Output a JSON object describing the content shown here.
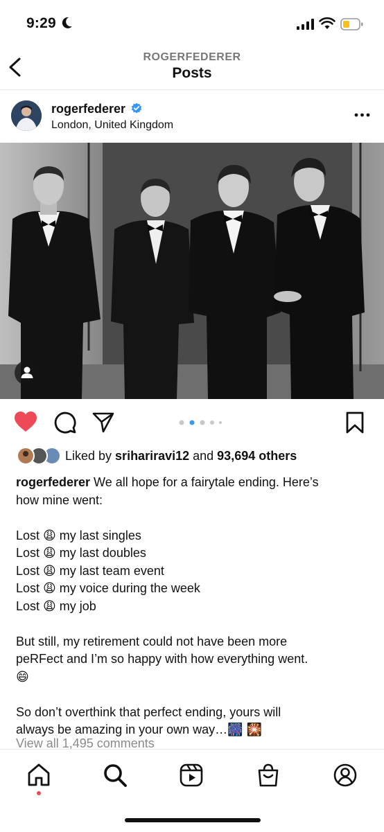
{
  "status_bar": {
    "time": "9:29"
  },
  "header": {
    "account": "ROGERFEDERER",
    "title": "Posts"
  },
  "post": {
    "username": "rogerfederer",
    "verified": true,
    "location": "London, United Kingdom",
    "carousel": {
      "count": 5,
      "active_index": 1
    },
    "liked_prefix": "Liked by ",
    "liked_user": "srihariravi12",
    "liked_mid": " and ",
    "liked_count": "93,694 others",
    "caption_lines": [
      {
        "text": "rogerfederer We all hope for a fairytale ending. Here’s"
      },
      {
        "text": "how mine went:"
      },
      {
        "text": ""
      },
      {
        "text": "Lost 😩 my last singles"
      },
      {
        "text": "Lost 😩 my last doubles"
      },
      {
        "text": "Lost 😩 my last team event"
      },
      {
        "text": "Lost 😩 my voice during the week"
      },
      {
        "text": "Lost 😩 my job"
      },
      {
        "text": ""
      },
      {
        "text": "But still, my retirement could not have been more"
      },
      {
        "text": "peRFect and I’m so happy with how everything went."
      },
      {
        "text": "😄"
      },
      {
        "text": ""
      },
      {
        "text": "So don’t overthink that perfect ending, yours will"
      },
      {
        "text": "always be amazing in your own way…🎆 🎇"
      }
    ],
    "view_comments": "View all 1,495 comments"
  },
  "tab_bar": [
    "home-tab",
    "search-tab",
    "reels-tab",
    "shop-tab",
    "profile-tab"
  ],
  "colors": {
    "like_red": "#ed4956",
    "verified_blue": "#3897f0",
    "carousel_active": "#3897f0"
  },
  "icons": [
    "back-icon",
    "more-icon",
    "heart-icon",
    "comment-icon",
    "share-icon",
    "bookmark-icon",
    "tagged-user-icon"
  ]
}
